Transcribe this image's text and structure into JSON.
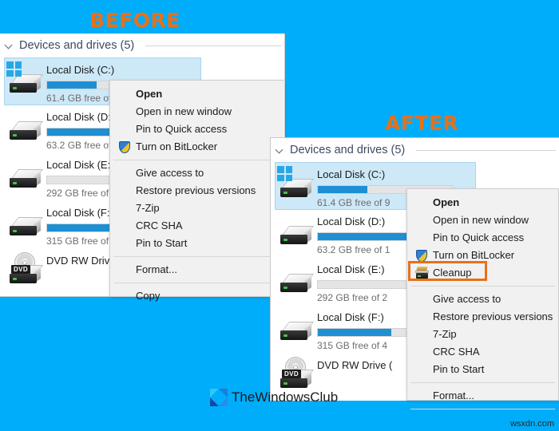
{
  "theme": {
    "background_color": "#00adfa",
    "accent_color": "#e8701a",
    "selection_color": "#cde8f7",
    "bar_fill_color": "#1e8fd3",
    "menu_background": "#f1f1f1"
  },
  "captions": {
    "before": "BEFORE",
    "after": "AFTER"
  },
  "explorer": {
    "group_header": "Devices and drives (5)",
    "drives": [
      {
        "name": "Local Disk (C:)",
        "free_text": "61.4 GB free of 9",
        "fill_percent": 37,
        "icon": "hard-drive-windows-icon",
        "selected": true
      },
      {
        "name": "Local Disk (D:)",
        "free_text": "63.2 GB free of 1",
        "fill_percent": 100,
        "icon": "hard-drive-icon",
        "selected": false
      },
      {
        "name": "Local Disk (E:)",
        "free_text": "292 GB free of 2",
        "fill_percent": 0,
        "icon": "hard-drive-icon",
        "selected": false
      },
      {
        "name": "Local Disk (F:)",
        "free_text": "315 GB free of 4",
        "fill_percent": 55,
        "icon": "hard-drive-icon",
        "selected": false
      },
      {
        "name": "DVD RW Drive (",
        "free_text": "",
        "fill_percent": 0,
        "icon": "dvd-drive-icon",
        "selected": false
      }
    ]
  },
  "context_menu_before": {
    "items": [
      {
        "label": "Open",
        "bold": true,
        "icon": null,
        "submenu": false
      },
      {
        "label": "Open in new window",
        "bold": false,
        "icon": null,
        "submenu": false
      },
      {
        "label": "Pin to Quick access",
        "bold": false,
        "icon": null,
        "submenu": false
      },
      {
        "label": "Turn on BitLocker",
        "bold": false,
        "icon": "shield-icon",
        "submenu": false
      },
      {
        "separator": true
      },
      {
        "label": "Give access to",
        "bold": false,
        "icon": null,
        "submenu": true
      },
      {
        "label": "Restore previous versions",
        "bold": false,
        "icon": null,
        "submenu": false
      },
      {
        "label": "7-Zip",
        "bold": false,
        "icon": null,
        "submenu": true
      },
      {
        "label": "CRC SHA",
        "bold": false,
        "icon": null,
        "submenu": true
      },
      {
        "label": "Pin to Start",
        "bold": false,
        "icon": null,
        "submenu": false
      },
      {
        "separator": true
      },
      {
        "label": "Format...",
        "bold": false,
        "icon": null,
        "submenu": false
      },
      {
        "separator": true
      },
      {
        "label": "Copy",
        "bold": false,
        "icon": null,
        "submenu": false
      }
    ]
  },
  "context_menu_after": {
    "items": [
      {
        "label": "Open",
        "bold": true,
        "icon": null,
        "submenu": false
      },
      {
        "label": "Open in new window",
        "bold": false,
        "icon": null,
        "submenu": false
      },
      {
        "label": "Pin to Quick access",
        "bold": false,
        "icon": null,
        "submenu": false
      },
      {
        "label": "Turn on BitLocker",
        "bold": false,
        "icon": "shield-icon",
        "submenu": false
      },
      {
        "label": "Cleanup",
        "bold": false,
        "icon": "cleanup-icon",
        "submenu": false,
        "highlighted": true
      },
      {
        "separator": true
      },
      {
        "label": "Give access to",
        "bold": false,
        "icon": null,
        "submenu": false
      },
      {
        "label": "Restore previous versions",
        "bold": false,
        "icon": null,
        "submenu": false
      },
      {
        "label": "7-Zip",
        "bold": false,
        "icon": null,
        "submenu": false
      },
      {
        "label": "CRC SHA",
        "bold": false,
        "icon": null,
        "submenu": false
      },
      {
        "label": "Pin to Start",
        "bold": false,
        "icon": null,
        "submenu": false
      },
      {
        "separator": true
      },
      {
        "label": "Format...",
        "bold": false,
        "icon": null,
        "submenu": false
      },
      {
        "separator": true
      }
    ]
  },
  "watermark": {
    "text": "TheWindowsClub",
    "logo": "thewindowsclub-logo-icon"
  },
  "footer": {
    "credit": "wsxdn.com"
  }
}
